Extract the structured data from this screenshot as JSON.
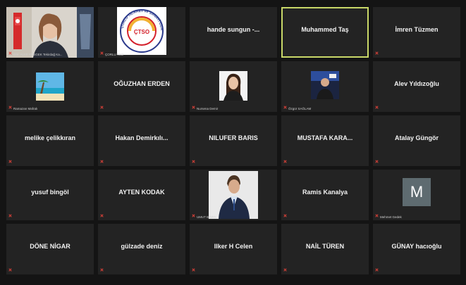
{
  "participants": [
    {
      "name": "",
      "label": "Gör. ALKE KESGEK Tekirdağ Ka..."
    },
    {
      "name": "",
      "label": "ÇORLU TSO"
    },
    {
      "name": "hande sungun -...",
      "label": ""
    },
    {
      "name": "Muhammed Taş",
      "label": "",
      "active": true
    },
    {
      "name": "İmren Tüzmen",
      "label": ""
    },
    {
      "name": "",
      "label": "Ramazan Mafralı"
    },
    {
      "name": "OĞUZHAN ERDEN",
      "label": ""
    },
    {
      "name": "",
      "label": "Nursena Demir"
    },
    {
      "name": "",
      "label": "Özgür SAĞLAM"
    },
    {
      "name": "Alev Yıldızoğlu",
      "label": ""
    },
    {
      "name": "melike çelikkıran",
      "label": ""
    },
    {
      "name": "Hakan  Demirkılı...",
      "label": ""
    },
    {
      "name": "NILUFER BARIS",
      "label": ""
    },
    {
      "name": "MUSTAFA  KARA...",
      "label": ""
    },
    {
      "name": "Atalay Güngör",
      "label": ""
    },
    {
      "name": "yusuf bingöl",
      "label": ""
    },
    {
      "name": "AYTEN KODAK",
      "label": ""
    },
    {
      "name": "",
      "label": "UMUT BOZO"
    },
    {
      "name": "Ramis Kanalya",
      "label": ""
    },
    {
      "name": "",
      "label": "Mehmet Gedek",
      "initial": "M"
    },
    {
      "name": "DÖNE NİGAR",
      "label": ""
    },
    {
      "name": "gülzade deniz",
      "label": ""
    },
    {
      "name": "Ilker H Celen",
      "label": ""
    },
    {
      "name": "NAİL TÜREN",
      "label": ""
    },
    {
      "name": "GÜNAY hacıoğlu",
      "label": ""
    }
  ],
  "logo": {
    "center_text": "ÇTSO",
    "ring_text": "ÇORLU TİCARET ve SANAYİ ODASI"
  },
  "colors": {
    "active_border": "#c9d868",
    "mic_muted": "#e0433a",
    "tile_bg": "#232323"
  }
}
